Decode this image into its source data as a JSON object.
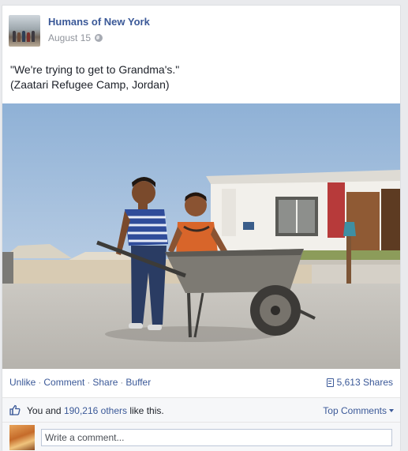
{
  "post": {
    "page_name": "Humans of New York",
    "date": "August 15",
    "privacy_icon": "globe-icon",
    "message_lines": [
      "\"We're trying to get to Grandma's.\"",
      "(Zaatari Refugee Camp, Jordan)"
    ]
  },
  "actions": {
    "unlike": "Unlike",
    "comment": "Comment",
    "share": "Share",
    "buffer": "Buffer",
    "share_count": "5,613 Shares"
  },
  "likes": {
    "prefix": "You and ",
    "others_link": "190,216 others",
    "suffix": " like this.",
    "top_comments": "Top Comments"
  },
  "comment_box": {
    "placeholder": "Write a comment..."
  },
  "colors": {
    "link": "#3b5998",
    "meta": "#90949c",
    "background": "#e9eaed"
  }
}
